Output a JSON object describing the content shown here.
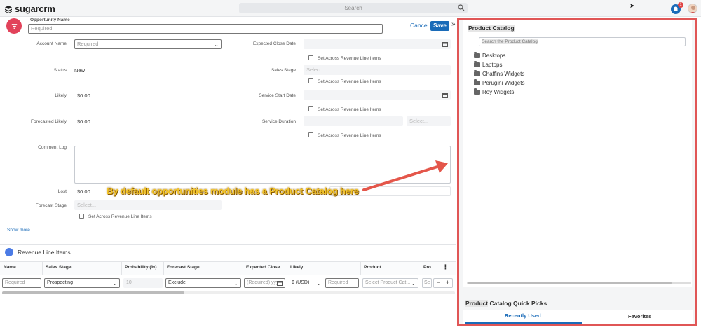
{
  "app": {
    "logo_text": "sugarcrm"
  },
  "topbar": {
    "search_placeholder": "Search",
    "notification_count": "1"
  },
  "header": {
    "opportunity_name_label": "Opportunity Name",
    "opportunity_name_placeholder": "Required",
    "cancel_label": "Cancel",
    "save_label": "Save",
    "collapse_icon": "»"
  },
  "form": {
    "account_name_label": "Account Name",
    "account_name_placeholder": "Required",
    "expected_close_label": "Expected Close Date",
    "set_across_label": "Set Across Revenue Line Items",
    "status_label": "Status",
    "status_value": "New",
    "sales_stage_label": "Sales Stage",
    "sales_stage_placeholder": "Select...",
    "likely_label": "Likely",
    "likely_value": "$0.00",
    "service_start_label": "Service Start Date",
    "forecasted_likely_label": "Forecasted Likely",
    "forecasted_likely_value": "$0.00",
    "service_duration_label": "Service Duration",
    "service_duration_placeholder": "Select...",
    "comment_log_label": "Comment Log",
    "lost_label": "Lost",
    "lost_value": "$0.00",
    "forecast_stage_label": "Forecast Stage",
    "forecast_stage_placeholder": "Select...",
    "show_more": "Show more..."
  },
  "annotation": "By default opportunities module has a Product Catalog here",
  "rli": {
    "title": "Revenue Line Items",
    "columns": [
      "Name",
      "Sales Stage",
      "Probability (%)",
      "Forecast Stage",
      "Expected Close ...",
      "Likely",
      "Product",
      "Pro"
    ],
    "row": {
      "name_placeholder": "Required",
      "sales_stage": "Prospecting",
      "probability": "10",
      "forecast_stage": "Exclude",
      "close_date_placeholder": "(Required) yyy",
      "currency": "$ (USD)",
      "likely_placeholder": "Required",
      "product_placeholder": "Select Product Cat...",
      "pro_placeholder": "Se",
      "minus": "−",
      "plus": "+"
    },
    "more_icon": "⋮"
  },
  "product_catalog": {
    "title": "Product Catalog",
    "search_placeholder": "Search the Product Catalog",
    "folders": [
      "Desktops",
      "Laptops",
      "Chaffins Widgets",
      "Perugini Widgets",
      "Roy Widgets"
    ]
  },
  "quick_picks": {
    "title_highlight": "Product",
    "title_rest": " Catalog Quick Picks",
    "tab_recent": "Recently Used",
    "tab_favorites": "Favorites"
  },
  "colors": {
    "accent": "#1a6bb8",
    "record_icon": "#e2425a",
    "highlight_border": "#e05656",
    "annotation": "#f4c52a"
  }
}
